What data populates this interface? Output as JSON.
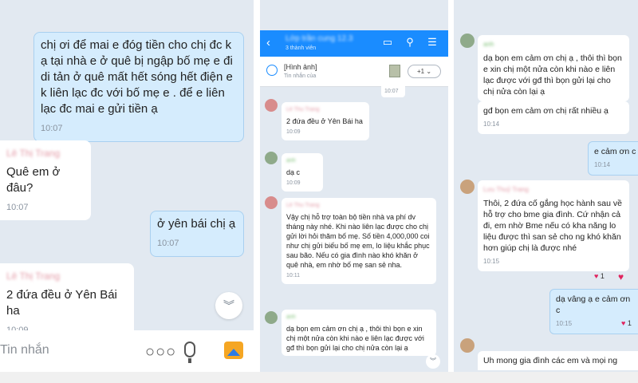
{
  "panel1": {
    "messages": [
      {
        "text": "chị ơi để mai e đóg tiền cho chị đc k ạ tại nhà e ở quê bị ngập bố mẹ e đi di tản ở quê mất hết sóng hết điện e k liên lạc đc với bố mẹ e . để e liên lạc đc mai e gửi tiền ạ",
        "time": "10:07"
      },
      {
        "sender": "Lê Thị Trang",
        "text": "Quê em ở đâu?",
        "time": "10:07"
      },
      {
        "text": "ở yên bái chị ạ",
        "time": "10:07"
      },
      {
        "sender": "Lê Thị Trang",
        "text": "2 đứa đều ở Yên Bái ha",
        "time": "10:09"
      }
    ],
    "input_placeholder": "Tin nhắn",
    "dots": "○○○"
  },
  "panel2": {
    "header": {
      "title": "Lớp trần cung 12.3",
      "subtitle": "3 thành viên"
    },
    "pinned": {
      "title": "[Hình ảnh]",
      "subtitle": "Tin nhắn của",
      "more": "+1"
    },
    "messages": [
      {
        "time": "10:07"
      },
      {
        "sender": "Lê Thu Trang",
        "text": "2 đứa đều ở Yên Bái ha",
        "time": "10:09"
      },
      {
        "sender": "anh",
        "text": "dạ c",
        "time": "10:09"
      },
      {
        "sender": "Lê Thu Trang",
        "text": "Vậy chị hỗ trợ toàn bộ tiền nhà va phí dv tháng này nhé. Khi nào liên lạc được cho chị gửi lời hỏi thăm bố mẹ. Số tiền 4,000,000 coi như chị gửi biếu bố mẹ em, lo liệu khắc phục sau bão. Nếu có gia đình nào khó khăn ở quê nhà, em nhờ bố mẹ san sẻ nha.",
        "time": "10:11"
      },
      {
        "sender": "anh",
        "text": "dạ bọn em cảm ơn chị ạ , thôi thì bọn e xin chị một nửa còn khi nào e liên lạc được với gđ thì bọn gửi lại cho chị nửa còn lại ạ"
      }
    ]
  },
  "panel3": {
    "messages": [
      {
        "sender": "anh",
        "text": "dạ bọn em cảm ơn chị ạ , thôi thì bọn e xin chị một nửa còn khi nào e liên lạc được với gđ thì bọn gửi lại cho chị nửa còn lại ạ"
      },
      {
        "text": "gđ bọn em cảm ơn chị rất nhiều ạ",
        "time": "10:14"
      },
      {
        "text": "e cảm ơn c",
        "time": "10:14"
      },
      {
        "sender": "Lưu Thuỷ Trang",
        "text": "Thôi, 2 đứa cố gắng học hành sau về hỗ trợ cho bme gia đình. Cứ nhận cả đi, em nhờ Bme nếu có kha năng lo liệu được thì san sẻ cho ng khó khăn hơn giúp chị là được nhé",
        "time": "10:15",
        "reaction": "1"
      },
      {
        "text": "dạ vâng ạ e cảm ơn c",
        "time": "10:15",
        "reaction": "1"
      },
      {
        "text": "Uh mong gia đình các em và mọi ng"
      }
    ]
  }
}
